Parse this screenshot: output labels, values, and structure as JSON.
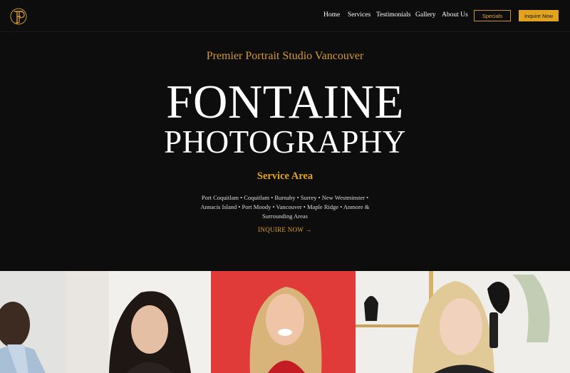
{
  "header": {
    "nav": [
      {
        "label": "Home"
      },
      {
        "label": "Services"
      },
      {
        "label": "Testimonials"
      },
      {
        "label": "Gallery"
      },
      {
        "label": "About Us"
      }
    ],
    "specials_label": "Specials",
    "inquire_label": "Inquire Now"
  },
  "hero": {
    "subtitle": "Premier Portrait Studio Vancouver",
    "brand_line1": "FONTAINE",
    "brand_line2": "PHOTOGRAPHY",
    "service_area_title": "Service Area",
    "service_area_text": "Port Coquitlam • Coquitlam • Burnaby • Surrey • New Westminster • Annacis Island • Port Moody • Vancouver • Maple Ridge • Anmore & Surrounding Areas",
    "cta_label": "INQUIRE NOW →"
  },
  "colors": {
    "background": "#0d0d0d",
    "accent": "#e2a31f",
    "subtitle_gold": "#d69a34"
  },
  "icons": {
    "logo": "fp-monogram-logo"
  }
}
